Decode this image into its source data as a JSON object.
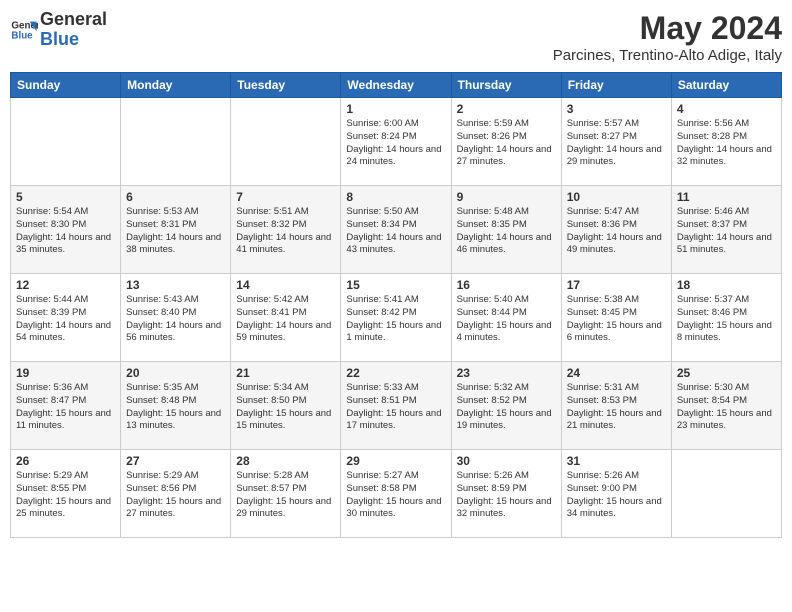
{
  "header": {
    "logo_line1": "General",
    "logo_line2": "Blue",
    "month": "May 2024",
    "location": "Parcines, Trentino-Alto Adige, Italy"
  },
  "weekdays": [
    "Sunday",
    "Monday",
    "Tuesday",
    "Wednesday",
    "Thursday",
    "Friday",
    "Saturday"
  ],
  "weeks": [
    [
      {
        "day": "",
        "content": ""
      },
      {
        "day": "",
        "content": ""
      },
      {
        "day": "",
        "content": ""
      },
      {
        "day": "1",
        "content": "Sunrise: 6:00 AM\nSunset: 8:24 PM\nDaylight: 14 hours\nand 24 minutes."
      },
      {
        "day": "2",
        "content": "Sunrise: 5:59 AM\nSunset: 8:26 PM\nDaylight: 14 hours\nand 27 minutes."
      },
      {
        "day": "3",
        "content": "Sunrise: 5:57 AM\nSunset: 8:27 PM\nDaylight: 14 hours\nand 29 minutes."
      },
      {
        "day": "4",
        "content": "Sunrise: 5:56 AM\nSunset: 8:28 PM\nDaylight: 14 hours\nand 32 minutes."
      }
    ],
    [
      {
        "day": "5",
        "content": "Sunrise: 5:54 AM\nSunset: 8:30 PM\nDaylight: 14 hours\nand 35 minutes."
      },
      {
        "day": "6",
        "content": "Sunrise: 5:53 AM\nSunset: 8:31 PM\nDaylight: 14 hours\nand 38 minutes."
      },
      {
        "day": "7",
        "content": "Sunrise: 5:51 AM\nSunset: 8:32 PM\nDaylight: 14 hours\nand 41 minutes."
      },
      {
        "day": "8",
        "content": "Sunrise: 5:50 AM\nSunset: 8:34 PM\nDaylight: 14 hours\nand 43 minutes."
      },
      {
        "day": "9",
        "content": "Sunrise: 5:48 AM\nSunset: 8:35 PM\nDaylight: 14 hours\nand 46 minutes."
      },
      {
        "day": "10",
        "content": "Sunrise: 5:47 AM\nSunset: 8:36 PM\nDaylight: 14 hours\nand 49 minutes."
      },
      {
        "day": "11",
        "content": "Sunrise: 5:46 AM\nSunset: 8:37 PM\nDaylight: 14 hours\nand 51 minutes."
      }
    ],
    [
      {
        "day": "12",
        "content": "Sunrise: 5:44 AM\nSunset: 8:39 PM\nDaylight: 14 hours\nand 54 minutes."
      },
      {
        "day": "13",
        "content": "Sunrise: 5:43 AM\nSunset: 8:40 PM\nDaylight: 14 hours\nand 56 minutes."
      },
      {
        "day": "14",
        "content": "Sunrise: 5:42 AM\nSunset: 8:41 PM\nDaylight: 14 hours\nand 59 minutes."
      },
      {
        "day": "15",
        "content": "Sunrise: 5:41 AM\nSunset: 8:42 PM\nDaylight: 15 hours\nand 1 minute."
      },
      {
        "day": "16",
        "content": "Sunrise: 5:40 AM\nSunset: 8:44 PM\nDaylight: 15 hours\nand 4 minutes."
      },
      {
        "day": "17",
        "content": "Sunrise: 5:38 AM\nSunset: 8:45 PM\nDaylight: 15 hours\nand 6 minutes."
      },
      {
        "day": "18",
        "content": "Sunrise: 5:37 AM\nSunset: 8:46 PM\nDaylight: 15 hours\nand 8 minutes."
      }
    ],
    [
      {
        "day": "19",
        "content": "Sunrise: 5:36 AM\nSunset: 8:47 PM\nDaylight: 15 hours\nand 11 minutes."
      },
      {
        "day": "20",
        "content": "Sunrise: 5:35 AM\nSunset: 8:48 PM\nDaylight: 15 hours\nand 13 minutes."
      },
      {
        "day": "21",
        "content": "Sunrise: 5:34 AM\nSunset: 8:50 PM\nDaylight: 15 hours\nand 15 minutes."
      },
      {
        "day": "22",
        "content": "Sunrise: 5:33 AM\nSunset: 8:51 PM\nDaylight: 15 hours\nand 17 minutes."
      },
      {
        "day": "23",
        "content": "Sunrise: 5:32 AM\nSunset: 8:52 PM\nDaylight: 15 hours\nand 19 minutes."
      },
      {
        "day": "24",
        "content": "Sunrise: 5:31 AM\nSunset: 8:53 PM\nDaylight: 15 hours\nand 21 minutes."
      },
      {
        "day": "25",
        "content": "Sunrise: 5:30 AM\nSunset: 8:54 PM\nDaylight: 15 hours\nand 23 minutes."
      }
    ],
    [
      {
        "day": "26",
        "content": "Sunrise: 5:29 AM\nSunset: 8:55 PM\nDaylight: 15 hours\nand 25 minutes."
      },
      {
        "day": "27",
        "content": "Sunrise: 5:29 AM\nSunset: 8:56 PM\nDaylight: 15 hours\nand 27 minutes."
      },
      {
        "day": "28",
        "content": "Sunrise: 5:28 AM\nSunset: 8:57 PM\nDaylight: 15 hours\nand 29 minutes."
      },
      {
        "day": "29",
        "content": "Sunrise: 5:27 AM\nSunset: 8:58 PM\nDaylight: 15 hours\nand 30 minutes."
      },
      {
        "day": "30",
        "content": "Sunrise: 5:26 AM\nSunset: 8:59 PM\nDaylight: 15 hours\nand 32 minutes."
      },
      {
        "day": "31",
        "content": "Sunrise: 5:26 AM\nSunset: 9:00 PM\nDaylight: 15 hours\nand 34 minutes."
      },
      {
        "day": "",
        "content": ""
      }
    ]
  ]
}
